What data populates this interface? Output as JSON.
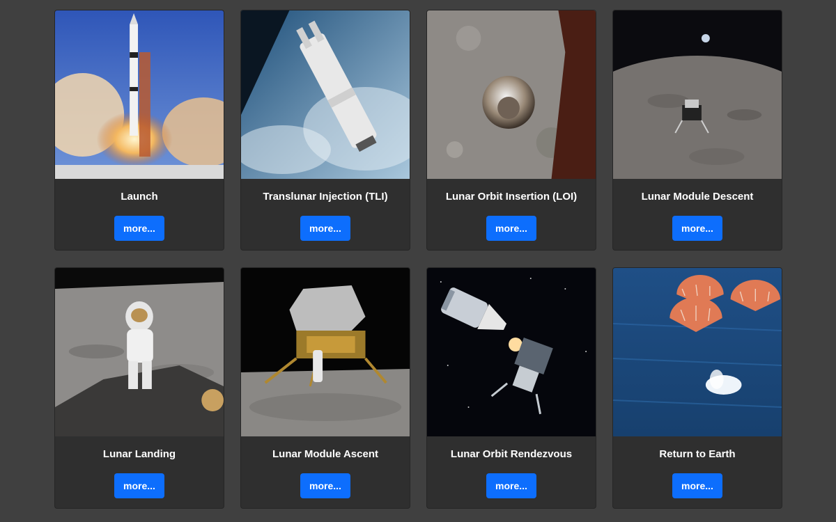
{
  "gallery": {
    "cards": [
      {
        "title": "Launch",
        "button": "more...",
        "image": "saturn-v-launch-photo"
      },
      {
        "title": "Translunar Injection (TLI)",
        "button": "more...",
        "image": "s-ivb-stage-over-earth-photo"
      },
      {
        "title": "Lunar Orbit Insertion (LOI)",
        "button": "more...",
        "image": "command-module-over-moon-photo"
      },
      {
        "title": "Lunar Module Descent",
        "button": "more...",
        "image": "lunar-module-over-moon-photo"
      },
      {
        "title": "Lunar Landing",
        "button": "more...",
        "image": "astronaut-on-moon-photo"
      },
      {
        "title": "Lunar Module Ascent",
        "button": "more...",
        "image": "lunar-module-on-surface-photo"
      },
      {
        "title": "Lunar Orbit Rendezvous",
        "button": "more...",
        "image": "csm-lm-docking-illustration"
      },
      {
        "title": "Return to Earth",
        "button": "more...",
        "image": "parachute-splashdown-photo"
      }
    ]
  },
  "colors": {
    "page_background": "#404040",
    "card_background": "#2f2f2f",
    "button_background": "#0d6efd",
    "text": "#ffffff"
  }
}
